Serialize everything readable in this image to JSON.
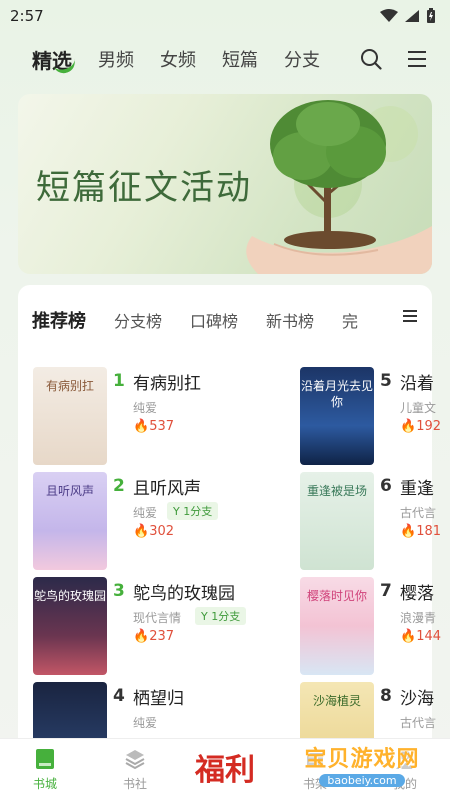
{
  "status_bar": {
    "time": "2:57"
  },
  "top_nav": {
    "tabs": [
      {
        "label": "精选",
        "active": true
      },
      {
        "label": "男频"
      },
      {
        "label": "女频"
      },
      {
        "label": "短篇"
      },
      {
        "label": "分支"
      }
    ],
    "icons": [
      "search-icon",
      "menu-icon"
    ]
  },
  "banner": {
    "title": "短篇征文活动"
  },
  "rank_card": {
    "tabs": [
      {
        "label": "推荐榜",
        "active": true
      },
      {
        "label": "分支榜"
      },
      {
        "label": "口碑榜"
      },
      {
        "label": "新书榜"
      },
      {
        "label": "完"
      }
    ],
    "books": [
      {
        "rank": "1",
        "title": "有病别扛",
        "genre": "纯爱",
        "hot": "537",
        "cover_text": "有病别扛"
      },
      {
        "rank": "2",
        "title": "且听风声",
        "genre": "纯爱",
        "tag": "1分支",
        "hot": "302",
        "cover_text": "且听风声"
      },
      {
        "rank": "3",
        "title": "鸵鸟的玫瑰园",
        "genre": "现代言情",
        "tag": "1分支",
        "hot": "237",
        "cover_text": "鸵鸟的玫瑰园"
      },
      {
        "rank": "4",
        "title": "栖望归",
        "genre": "纯爱",
        "cover_text": ""
      },
      {
        "rank": "5",
        "title": "沿着",
        "genre": "儿童文",
        "hot": "192",
        "cover_text": "沿着月光去见你"
      },
      {
        "rank": "6",
        "title": "重逢",
        "genre": "古代言",
        "hot": "181",
        "cover_text": "重逢被是场"
      },
      {
        "rank": "7",
        "title": "樱落",
        "genre": "浪漫青",
        "hot": "144",
        "cover_text": "樱落时见你"
      },
      {
        "rank": "8",
        "title": "沙海",
        "genre": "古代言",
        "cover_text": "沙海植灵"
      }
    ]
  },
  "bottom_nav": {
    "items": [
      {
        "label": "书城",
        "active": true
      },
      {
        "label": "书社"
      },
      {
        "label": "福利"
      },
      {
        "label": "书架"
      },
      {
        "label": "我的"
      }
    ]
  },
  "watermark": {
    "text": "宝贝游戏网",
    "url": "baobeiy.com"
  },
  "colors": {
    "accent": "#46b03c",
    "hot": "#e0503c",
    "rank_num": "#46b03c"
  }
}
